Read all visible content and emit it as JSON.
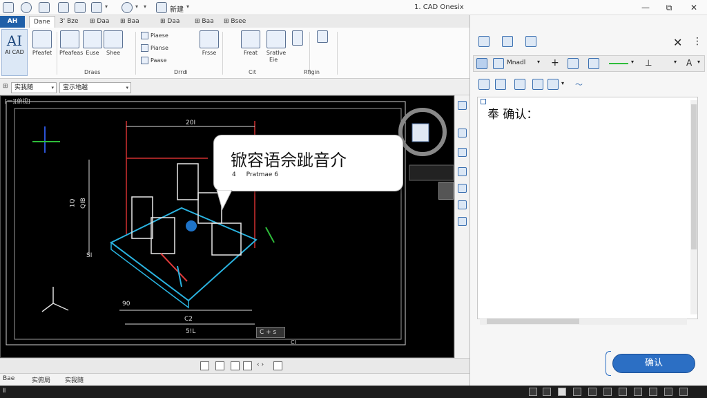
{
  "window": {
    "title": "1. CAD Onesix",
    "controls": {
      "minimize": "—",
      "restore": "⧉",
      "close": "✕"
    },
    "quick_access_label": "新建"
  },
  "ribbon": {
    "tabs": [
      "AH",
      "Dane",
      "3' Bze",
      "⊞ Daa",
      "⊞ Baa",
      "⊞ Daa",
      "⊞ Baa",
      "⊞ Bsee"
    ],
    "aicad_glyph": "AI",
    "aicad_label": "AI CAD",
    "big_buttons": [
      "Pfeafet",
      "Pfeafeas",
      "Euse",
      "Shee",
      "Frsse",
      "Freat",
      "Sratlve"
    ],
    "small_items": [
      "Piaese",
      "Pianse",
      "Paase",
      "Eie"
    ],
    "group_labels": [
      "Draes",
      "Drrdi",
      "Cit",
      "Rfigin"
    ]
  },
  "layer_row": {
    "layer_combo": "实我随",
    "style_combo": "宝示地越"
  },
  "viewport": {
    "label": "[一][俯视]",
    "dims_top": "20I",
    "dims_left": "1Q",
    "dims_left2": "QIB",
    "dims_bottom": [
      "90",
      "C2",
      "5!L"
    ],
    "dim_s": "SI",
    "coord_label": "C + s",
    "coord_sub": "CI"
  },
  "bubble": {
    "title": "锨容语佘跐音介",
    "subtitle_num": "4",
    "subtitle_text": "Pratmae 6"
  },
  "model_tabs": [
    "Bae",
    "实俯局",
    "实我随"
  ],
  "right_panel": {
    "text": "奉 确认：",
    "line_weight_label": "Mnadl",
    "font_label": "A",
    "confirm": "确认"
  },
  "status_bar": {
    "left": "Ⅱ"
  },
  "colors": {
    "accent": "#2c6fc4",
    "file_tab": "#1f5fa8",
    "viewport_bg": "#000000",
    "line_green": "#2ebd3a"
  }
}
